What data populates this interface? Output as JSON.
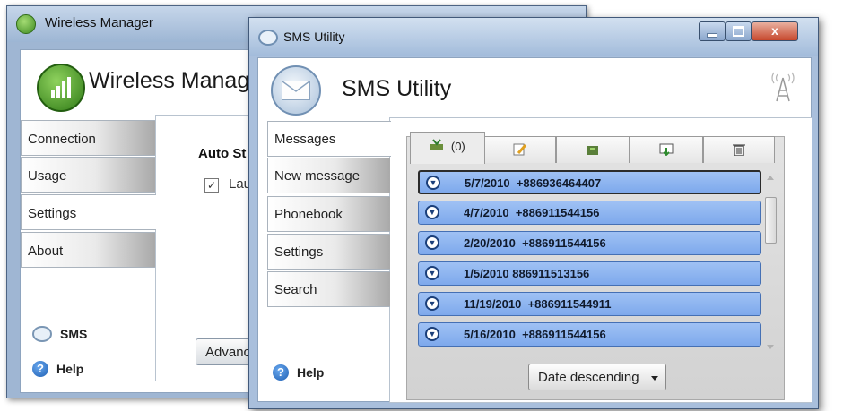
{
  "wireless_manager": {
    "title": "Wireless Manager",
    "header": "Wireless Manag",
    "nav": [
      {
        "label": "Connection"
      },
      {
        "label": "Usage"
      },
      {
        "label": "Settings"
      },
      {
        "label": "About"
      }
    ],
    "settings": {
      "section_title": "Auto St",
      "checkbox_label": "Lau",
      "checkbox_mark": "✓",
      "advanced_button": "Advance"
    },
    "bottom_links": {
      "sms": "SMS",
      "help": "Help"
    }
  },
  "sms_utility": {
    "title": "SMS Utility",
    "header": "SMS Utility",
    "window_buttons": {
      "close": "x"
    },
    "nav": [
      {
        "label": "Messages"
      },
      {
        "label": "New message"
      },
      {
        "label": "Phonebook"
      },
      {
        "label": "Settings"
      },
      {
        "label": "Search"
      }
    ],
    "tabs": [
      {
        "icon": "inbox-icon",
        "count": "(0)"
      },
      {
        "icon": "compose-icon"
      },
      {
        "icon": "sent-icon"
      },
      {
        "icon": "draft-icon"
      },
      {
        "icon": "trash-icon"
      }
    ],
    "messages": [
      {
        "date": "5/7/2010",
        "number": "+886936464407"
      },
      {
        "date": "4/7/2010",
        "number": "+886911544156"
      },
      {
        "date": "2/20/2010",
        "number": "+886911544156"
      },
      {
        "date": "1/5/2010",
        "number": "886911513156"
      },
      {
        "date": "11/19/2010",
        "number": "+886911544911"
      },
      {
        "date": "5/16/2010",
        "number": "+886911544156"
      }
    ],
    "sort": {
      "selected": "Date descending"
    },
    "help": "Help"
  },
  "colors": {
    "message_fill": "#8fb5f0",
    "title_bar": "#a9bfdc",
    "close_button": "#c6472c"
  }
}
